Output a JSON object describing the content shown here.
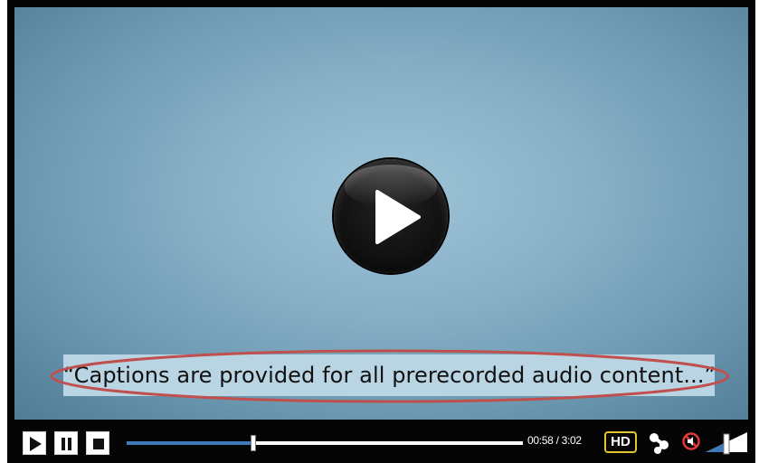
{
  "video": {
    "caption": "“Captions are provided for all prerecorded audio content...”"
  },
  "controls": {
    "progress_fraction": 0.32,
    "time_display": "00:58 / 3:02",
    "hd_label": "HD",
    "volume_fraction": 0.5
  },
  "icons": {
    "big_play": "play-circle-icon",
    "play": "play-icon",
    "pause": "pause-icon",
    "stop": "stop-icon",
    "share": "share-icon",
    "mute": "mute-icon",
    "volume": "volume-ramp-icon"
  },
  "colors": {
    "accent": "#3e7bb8",
    "hd_border": "#e2c62f",
    "caption_highlight": "#c0504d",
    "caption_background": "#b9d4e2"
  }
}
